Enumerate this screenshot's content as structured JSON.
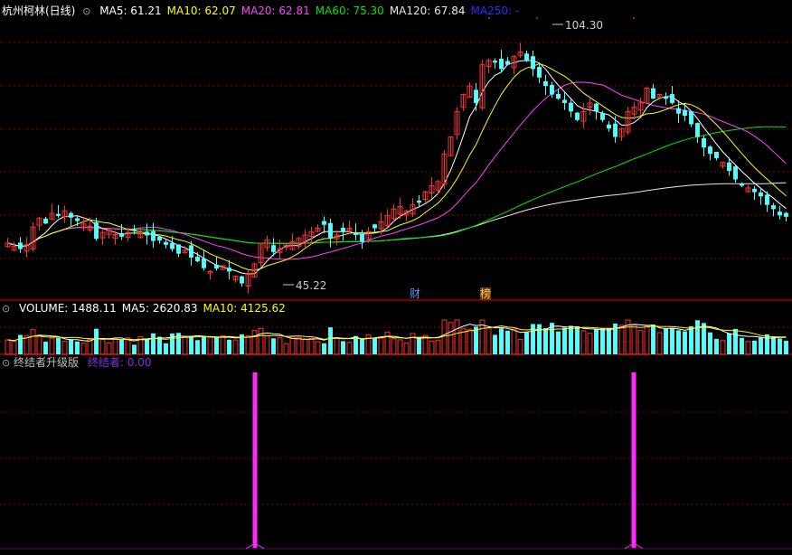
{
  "colors": {
    "background": "#000000",
    "up": "#ff3232",
    "down": "#54ffff",
    "ma5": "#ffffff",
    "ma10": "#ffff00",
    "ma20": "#ff44ff",
    "ma60": "#00e600",
    "ma120": "#e8e8e8",
    "ma250": "#2c2cff",
    "grid": "#8b0000",
    "signal": "#ff2aff"
  },
  "price_panel": {
    "title": "杭州柯林(日线)",
    "collapse_icon": "chevron-down-icon",
    "indicators": [
      {
        "name": "MA5",
        "value": "61.21",
        "color": "#ffffff"
      },
      {
        "name": "MA10",
        "value": "62.07",
        "color": "#ffff00"
      },
      {
        "name": "MA20",
        "value": "62.81",
        "color": "#ff44ff"
      },
      {
        "name": "MA60",
        "value": "75.30",
        "color": "#00e600"
      },
      {
        "name": "MA120",
        "value": "67.84",
        "color": "#e8e8e8"
      },
      {
        "name": "MA250",
        "value": "-",
        "color": "#2c2cff"
      }
    ],
    "high_marker": "104.30",
    "low_marker": "45.22",
    "event_markers": [
      "财",
      "榜"
    ]
  },
  "volume_panel": {
    "collapse_icon": "chevron-down-icon",
    "indicators": [
      {
        "name": "VOLUME",
        "value": "1488.11",
        "color": "#ffffff"
      },
      {
        "name": "MA5",
        "value": "2620.83",
        "color": "#ffffff"
      },
      {
        "name": "MA10",
        "value": "4125.62",
        "color": "#ffff00"
      }
    ]
  },
  "signal_panel": {
    "collapse_icon": "chevron-down-icon",
    "title": "终结者升级版",
    "indicator_name": "终结者",
    "indicator_value": "0.00",
    "indicator_color": "#8a2be2"
  },
  "chart_data": [
    {
      "type": "candlestick",
      "title": "杭州柯林(日线)",
      "y_range_approx": [
        42,
        108
      ],
      "high": 104.3,
      "low": 45.22,
      "close_approx": [
        55.0,
        54.2,
        53.6,
        54.6,
        58.8,
        60.8,
        59.6,
        62.0,
        61.4,
        62.6,
        61.0,
        60.2,
        59.5,
        59.0,
        56.0,
        57.5,
        58.0,
        57.0,
        56.5,
        57.5,
        58.0,
        57.2,
        56.8,
        55.5,
        55.6,
        54.6,
        53.6,
        52.5,
        53.3,
        51.6,
        50.7,
        49.1,
        48.3,
        49.0,
        49.7,
        48.3,
        47.2,
        45.5,
        47.9,
        50.1,
        54.9,
        55.7,
        52.9,
        53.7,
        54.5,
        55.3,
        56.1,
        56.9,
        57.7,
        58.5,
        59.3,
        56.1,
        56.9,
        57.7,
        58.5,
        56.9,
        55.3,
        57.7,
        58.5,
        60.0,
        61.5,
        63.0,
        63.6,
        62.5,
        64.0,
        64.5,
        67.0,
        68.5,
        69.5,
        76.0,
        80.0,
        86.0,
        90.0,
        92.0,
        88.0,
        97.0,
        98.0,
        97.5,
        96.0,
        97.0,
        99.0,
        100.0,
        98.0,
        96.0,
        94.0,
        92.0,
        90.0,
        89.0,
        88.0,
        86.0,
        84.0,
        86.0,
        88.0,
        86.0,
        84.0,
        82.0,
        80.0,
        82.0,
        86.0,
        87.0,
        88.0,
        91.5,
        89.0,
        90.0,
        89.0,
        88.0,
        85.5,
        85.0,
        83.0,
        80.0,
        77.5,
        76.0,
        75.0,
        74.0,
        72.0,
        70.0,
        68.5,
        68.0,
        67.0,
        66.0,
        64.0,
        63.0,
        61.5,
        61.2
      ]
    },
    {
      "type": "bar",
      "title": "VOLUME",
      "series_name": "VOLUME"
    },
    {
      "type": "bar",
      "title": "终结者升级版",
      "series_name": "终结者",
      "current_value": 0.0,
      "signal_spikes_count": 2
    }
  ]
}
